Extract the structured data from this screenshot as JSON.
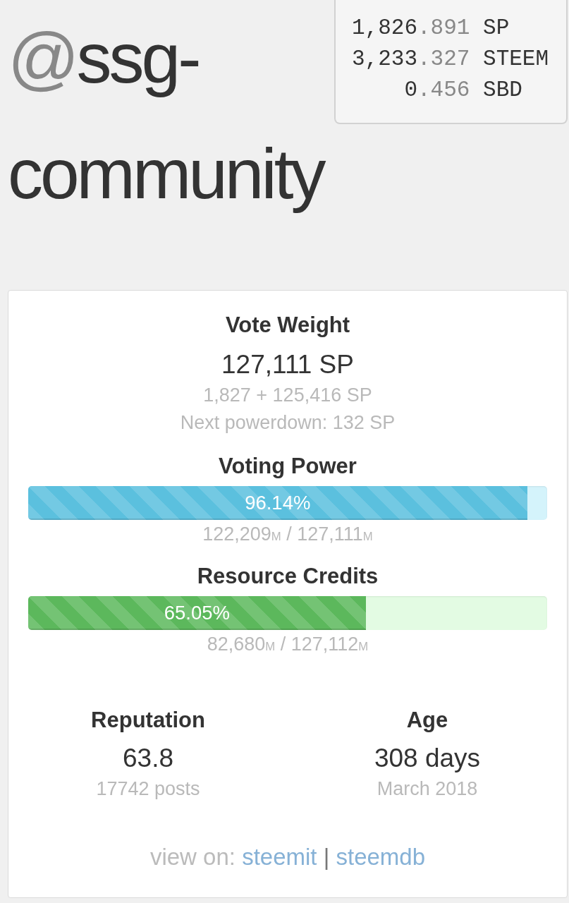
{
  "account": {
    "prefix": "@",
    "name": "ssg-community"
  },
  "balances": [
    {
      "whole": "1,826",
      "fraction": ".891",
      "unit": "SP"
    },
    {
      "whole": "3,233",
      "fraction": ".327",
      "unit": "STEEM"
    },
    {
      "whole": "0",
      "fraction": ".456",
      "unit": "SBD"
    }
  ],
  "vote_weight": {
    "title": "Vote Weight",
    "value": "127,111 SP",
    "lines": [
      "1,827 + 125,416 SP",
      "Next powerdown: 132 SP"
    ]
  },
  "meters": [
    {
      "kind": "info",
      "title": "Voting Power",
      "level": 0.9614,
      "label": "96.14%",
      "reading": "122,209$_{M}$ / 127,111$_{M}$"
    },
    {
      "kind": "success",
      "title": "Resource Credits",
      "level": 0.6505,
      "label": "65.05%",
      "reading": "82,680$_{M}$ / 127,112$_{M}$"
    }
  ],
  "stats": [
    {
      "title": "Reputation",
      "value": "63.8",
      "detail": "17742 posts"
    },
    {
      "title": "Age",
      "value": "308 days",
      "detail": "March 2018"
    }
  ],
  "view_on": {
    "label": "view on:",
    "links": [
      "steemit",
      "steemdb"
    ],
    "separator": "|"
  }
}
